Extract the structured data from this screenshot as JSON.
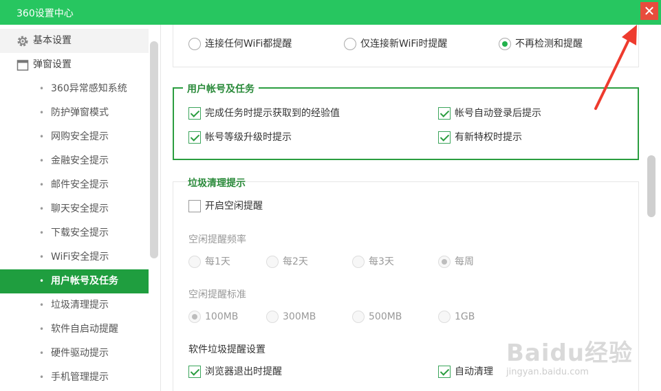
{
  "window": {
    "title": "360设置中心",
    "close_glyph": "✕",
    "close_color": "#e84c3d",
    "titlebar_color": "#27c660"
  },
  "sidebar": {
    "top_items": [
      {
        "label": "基本设置",
        "icon": "gear-icon"
      },
      {
        "label": "弹窗设置",
        "icon": "window-icon"
      }
    ],
    "sub_items": [
      "360异常感知系统",
      "防护弹窗模式",
      "网购安全提示",
      "金融安全提示",
      "邮件安全提示",
      "聊天安全提示",
      "下载安全提示",
      "WiFi安全提示",
      "用户帐号及任务",
      "垃圾清理提示",
      "软件自启动提醒",
      "硬件驱动提示",
      "手机管理提示"
    ],
    "active_index": 8,
    "dot": "•"
  },
  "wifi": {
    "options": [
      "连接任何WiFi都提醒",
      "仅连接新WiFi时提醒",
      "不再检测和提醒"
    ],
    "selected": 2
  },
  "account": {
    "title": "用户帐号及任务",
    "items": [
      "完成任务时提示获取到的经验值",
      "帐号自动登录后提示",
      "帐号等级升级时提示",
      "有新特权时提示"
    ]
  },
  "junk": {
    "title": "垃圾清理提示",
    "idle_toggle": "开启空闲提醒",
    "freq_title": "空闲提醒频率",
    "freq_options": [
      "每1天",
      "每2天",
      "每3天",
      "每周"
    ],
    "freq_selected": 3,
    "std_title": "空闲提醒标准",
    "std_options": [
      "100MB",
      "300MB",
      "500MB",
      "1GB"
    ],
    "std_selected": 0,
    "software_title": "软件垃圾提醒设置",
    "software_items": [
      "浏览器退出时提醒",
      "自动清理"
    ]
  },
  "watermark": {
    "main": "Baidu经验",
    "sub": "jingyan.baidu.com"
  },
  "accent_color": "#1f9e3f"
}
